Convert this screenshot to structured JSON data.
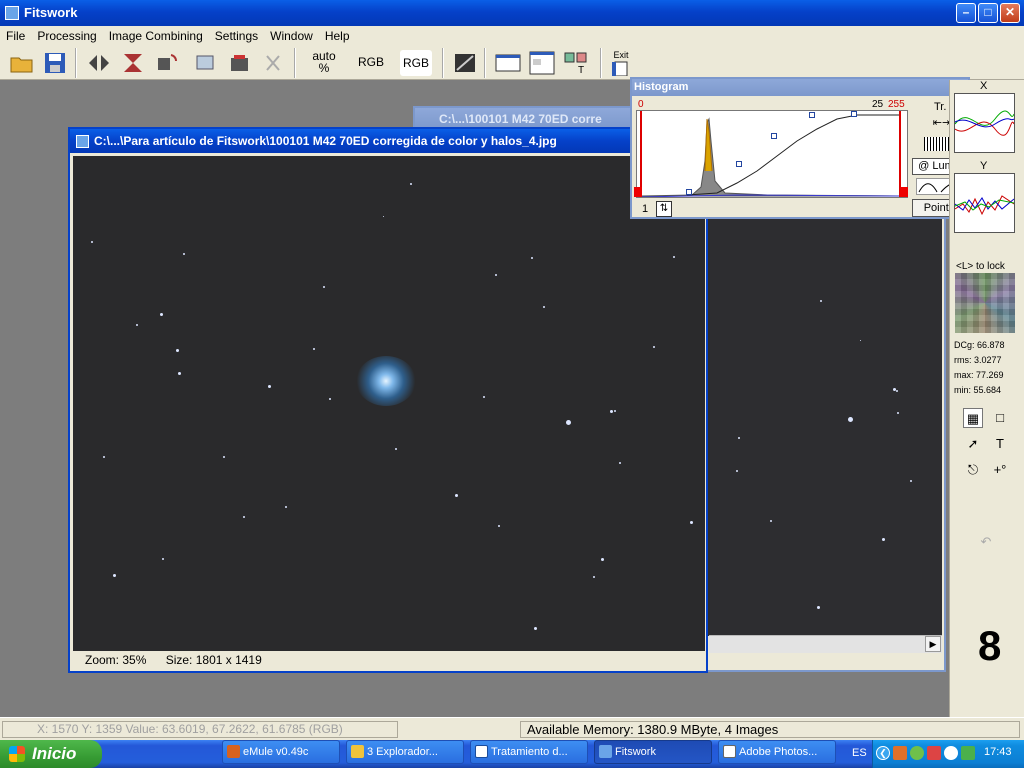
{
  "app": {
    "title": "Fitswork"
  },
  "menu": [
    "File",
    "Processing",
    "Image Combining",
    "Settings",
    "Window",
    "Help"
  ],
  "toolbar": {
    "auto_label": "auto\n%",
    "rgb1": "RGB",
    "rgb2": "RGB",
    "exit": "Exit"
  },
  "main_window": {
    "title": "C:\\...\\Para artículo de Fitswork\\100101 M42 70ED corregida de color y halos_4.jpg",
    "zoom": "Zoom: 35%",
    "size": "Size: 1801 x 1419"
  },
  "back_window": {
    "title": "C:\\...\\100101 M42 70ED corre"
  },
  "histogram": {
    "title": "Histogram",
    "left_value": "0",
    "right_value_a": "25",
    "right_value_b": "255",
    "tr_label": "Tr.",
    "luma_label": "@ Luma",
    "points_label": "Points",
    "bottom_value": "1"
  },
  "side_panel": {
    "x_label": "X",
    "y_label": "Y",
    "lock_label": "<L> to lock",
    "dcg": "DCg: 66.878",
    "rms": "rms: 3.0277",
    "max": "max: 77.269",
    "min": "min: 55.684",
    "big_number": "8"
  },
  "status": {
    "coords": "X: 1570  Y: 1359  Value: 63.6019, 67.2622, 61.6785 (RGB)",
    "memory": "Available Memory: 1380.9 MByte, 4 Images"
  },
  "taskbar": {
    "start": "Inicio",
    "items": [
      "eMule v0.49c",
      "3 Explorador...",
      "Tratamiento d...",
      "Fitswork",
      "Adobe Photos..."
    ],
    "lang": "ES",
    "clock": "17:43"
  },
  "colors": {
    "xp_blue": "#0541c9",
    "start_green": "#3a9a35",
    "tray": "#0f8cdf",
    "image_bg": "#2a2a2c"
  }
}
